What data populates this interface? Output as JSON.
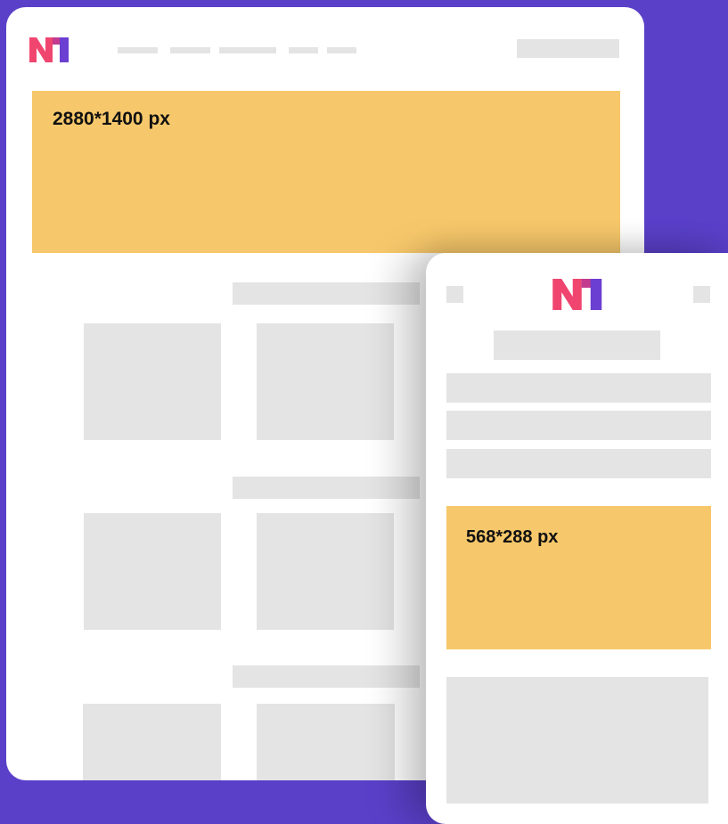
{
  "desktop": {
    "logo": {
      "name": "n1-logo",
      "colors": {
        "pink": "#f0456f",
        "purple": "#6a3fd1"
      }
    },
    "banner": {
      "label": "2880*1400 px",
      "color": "#f7c86b"
    }
  },
  "mobile": {
    "logo": {
      "name": "n1-logo",
      "colors": {
        "pink": "#f0456f",
        "purple": "#6a3fd1"
      }
    },
    "banner": {
      "label": "568*288 px",
      "color": "#f7c86b"
    }
  },
  "colors": {
    "background": "#5a40c9",
    "placeholder": "#e4e4e4",
    "card": "#ffffff"
  }
}
